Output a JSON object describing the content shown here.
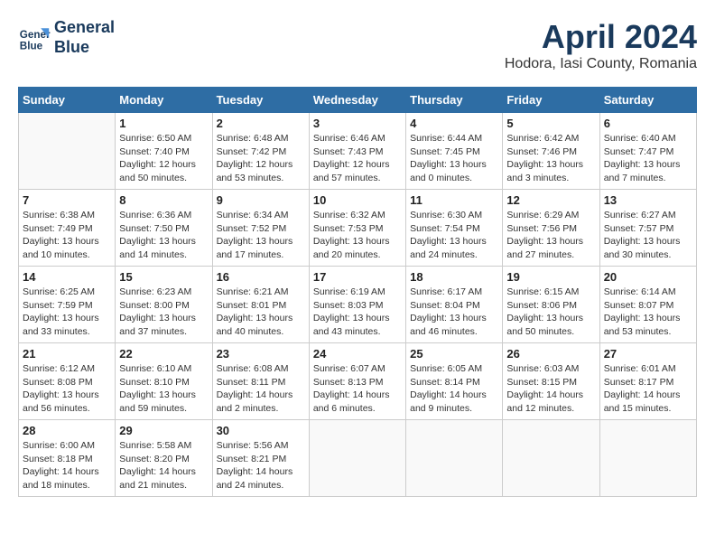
{
  "header": {
    "logo_line1": "General",
    "logo_line2": "Blue",
    "month": "April 2024",
    "location": "Hodora, Iasi County, Romania"
  },
  "weekdays": [
    "Sunday",
    "Monday",
    "Tuesday",
    "Wednesday",
    "Thursday",
    "Friday",
    "Saturday"
  ],
  "weeks": [
    [
      {
        "day": "",
        "info": ""
      },
      {
        "day": "1",
        "info": "Sunrise: 6:50 AM\nSunset: 7:40 PM\nDaylight: 12 hours\nand 50 minutes."
      },
      {
        "day": "2",
        "info": "Sunrise: 6:48 AM\nSunset: 7:42 PM\nDaylight: 12 hours\nand 53 minutes."
      },
      {
        "day": "3",
        "info": "Sunrise: 6:46 AM\nSunset: 7:43 PM\nDaylight: 12 hours\nand 57 minutes."
      },
      {
        "day": "4",
        "info": "Sunrise: 6:44 AM\nSunset: 7:45 PM\nDaylight: 13 hours\nand 0 minutes."
      },
      {
        "day": "5",
        "info": "Sunrise: 6:42 AM\nSunset: 7:46 PM\nDaylight: 13 hours\nand 3 minutes."
      },
      {
        "day": "6",
        "info": "Sunrise: 6:40 AM\nSunset: 7:47 PM\nDaylight: 13 hours\nand 7 minutes."
      }
    ],
    [
      {
        "day": "7",
        "info": "Sunrise: 6:38 AM\nSunset: 7:49 PM\nDaylight: 13 hours\nand 10 minutes."
      },
      {
        "day": "8",
        "info": "Sunrise: 6:36 AM\nSunset: 7:50 PM\nDaylight: 13 hours\nand 14 minutes."
      },
      {
        "day": "9",
        "info": "Sunrise: 6:34 AM\nSunset: 7:52 PM\nDaylight: 13 hours\nand 17 minutes."
      },
      {
        "day": "10",
        "info": "Sunrise: 6:32 AM\nSunset: 7:53 PM\nDaylight: 13 hours\nand 20 minutes."
      },
      {
        "day": "11",
        "info": "Sunrise: 6:30 AM\nSunset: 7:54 PM\nDaylight: 13 hours\nand 24 minutes."
      },
      {
        "day": "12",
        "info": "Sunrise: 6:29 AM\nSunset: 7:56 PM\nDaylight: 13 hours\nand 27 minutes."
      },
      {
        "day": "13",
        "info": "Sunrise: 6:27 AM\nSunset: 7:57 PM\nDaylight: 13 hours\nand 30 minutes."
      }
    ],
    [
      {
        "day": "14",
        "info": "Sunrise: 6:25 AM\nSunset: 7:59 PM\nDaylight: 13 hours\nand 33 minutes."
      },
      {
        "day": "15",
        "info": "Sunrise: 6:23 AM\nSunset: 8:00 PM\nDaylight: 13 hours\nand 37 minutes."
      },
      {
        "day": "16",
        "info": "Sunrise: 6:21 AM\nSunset: 8:01 PM\nDaylight: 13 hours\nand 40 minutes."
      },
      {
        "day": "17",
        "info": "Sunrise: 6:19 AM\nSunset: 8:03 PM\nDaylight: 13 hours\nand 43 minutes."
      },
      {
        "day": "18",
        "info": "Sunrise: 6:17 AM\nSunset: 8:04 PM\nDaylight: 13 hours\nand 46 minutes."
      },
      {
        "day": "19",
        "info": "Sunrise: 6:15 AM\nSunset: 8:06 PM\nDaylight: 13 hours\nand 50 minutes."
      },
      {
        "day": "20",
        "info": "Sunrise: 6:14 AM\nSunset: 8:07 PM\nDaylight: 13 hours\nand 53 minutes."
      }
    ],
    [
      {
        "day": "21",
        "info": "Sunrise: 6:12 AM\nSunset: 8:08 PM\nDaylight: 13 hours\nand 56 minutes."
      },
      {
        "day": "22",
        "info": "Sunrise: 6:10 AM\nSunset: 8:10 PM\nDaylight: 13 hours\nand 59 minutes."
      },
      {
        "day": "23",
        "info": "Sunrise: 6:08 AM\nSunset: 8:11 PM\nDaylight: 14 hours\nand 2 minutes."
      },
      {
        "day": "24",
        "info": "Sunrise: 6:07 AM\nSunset: 8:13 PM\nDaylight: 14 hours\nand 6 minutes."
      },
      {
        "day": "25",
        "info": "Sunrise: 6:05 AM\nSunset: 8:14 PM\nDaylight: 14 hours\nand 9 minutes."
      },
      {
        "day": "26",
        "info": "Sunrise: 6:03 AM\nSunset: 8:15 PM\nDaylight: 14 hours\nand 12 minutes."
      },
      {
        "day": "27",
        "info": "Sunrise: 6:01 AM\nSunset: 8:17 PM\nDaylight: 14 hours\nand 15 minutes."
      }
    ],
    [
      {
        "day": "28",
        "info": "Sunrise: 6:00 AM\nSunset: 8:18 PM\nDaylight: 14 hours\nand 18 minutes."
      },
      {
        "day": "29",
        "info": "Sunrise: 5:58 AM\nSunset: 8:20 PM\nDaylight: 14 hours\nand 21 minutes."
      },
      {
        "day": "30",
        "info": "Sunrise: 5:56 AM\nSunset: 8:21 PM\nDaylight: 14 hours\nand 24 minutes."
      },
      {
        "day": "",
        "info": ""
      },
      {
        "day": "",
        "info": ""
      },
      {
        "day": "",
        "info": ""
      },
      {
        "day": "",
        "info": ""
      }
    ]
  ]
}
